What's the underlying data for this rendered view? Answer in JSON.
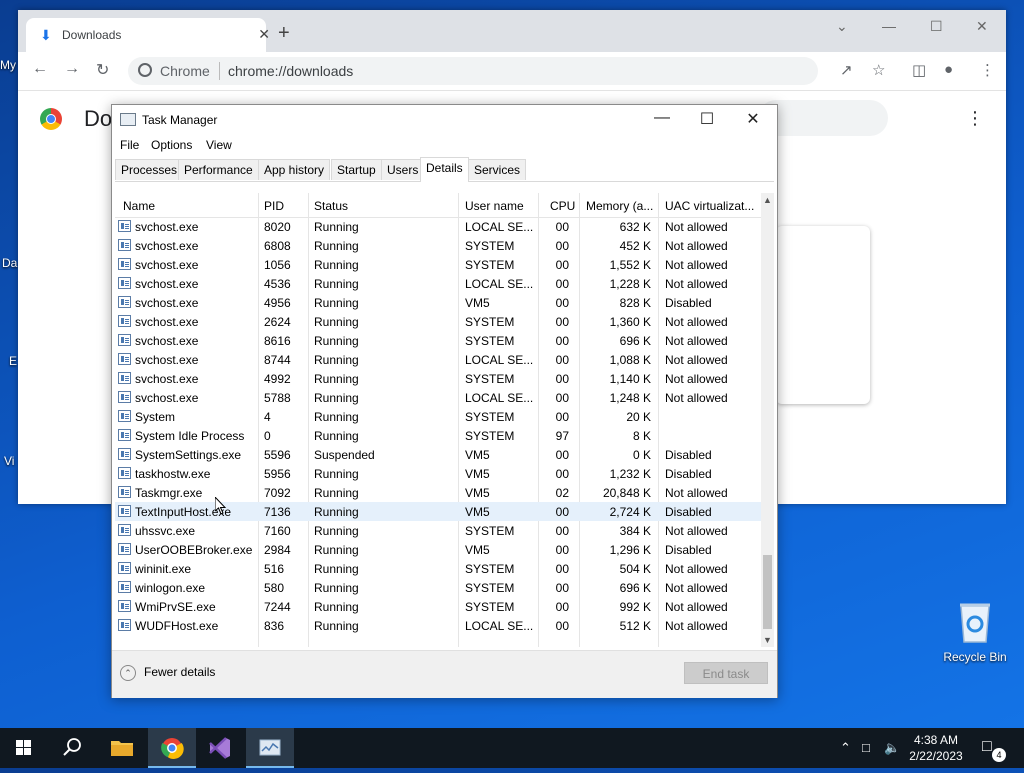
{
  "desktop": {
    "icons": [
      {
        "label": "My"
      },
      {
        "label": "Da"
      },
      {
        "label": "E"
      },
      {
        "label": "Vi"
      }
    ],
    "recycle_bin": "Recycle Bin"
  },
  "chrome": {
    "tab_title": "Downloads",
    "site_label": "Chrome",
    "url": "chrome://downloads",
    "page_title": "Do"
  },
  "task_manager": {
    "title": "Task Manager",
    "menu": [
      "File",
      "Options",
      "View"
    ],
    "tabs": [
      "Processes",
      "Performance",
      "App history",
      "Startup",
      "Users",
      "Details",
      "Services"
    ],
    "active_tab": "Details",
    "columns": [
      "Name",
      "PID",
      "Status",
      "User name",
      "CPU",
      "Memory (a...",
      "UAC virtualizat..."
    ],
    "rows": [
      {
        "name": "svchost.exe",
        "pid": "8020",
        "status": "Running",
        "user": "LOCAL SE...",
        "cpu": "00",
        "mem": "632 K",
        "uac": "Not allowed"
      },
      {
        "name": "svchost.exe",
        "pid": "6808",
        "status": "Running",
        "user": "SYSTEM",
        "cpu": "00",
        "mem": "452 K",
        "uac": "Not allowed"
      },
      {
        "name": "svchost.exe",
        "pid": "1056",
        "status": "Running",
        "user": "SYSTEM",
        "cpu": "00",
        "mem": "1,552 K",
        "uac": "Not allowed"
      },
      {
        "name": "svchost.exe",
        "pid": "4536",
        "status": "Running",
        "user": "LOCAL SE...",
        "cpu": "00",
        "mem": "1,228 K",
        "uac": "Not allowed"
      },
      {
        "name": "svchost.exe",
        "pid": "4956",
        "status": "Running",
        "user": "VM5",
        "cpu": "00",
        "mem": "828 K",
        "uac": "Disabled"
      },
      {
        "name": "svchost.exe",
        "pid": "2624",
        "status": "Running",
        "user": "SYSTEM",
        "cpu": "00",
        "mem": "1,360 K",
        "uac": "Not allowed"
      },
      {
        "name": "svchost.exe",
        "pid": "8616",
        "status": "Running",
        "user": "SYSTEM",
        "cpu": "00",
        "mem": "696 K",
        "uac": "Not allowed"
      },
      {
        "name": "svchost.exe",
        "pid": "8744",
        "status": "Running",
        "user": "LOCAL SE...",
        "cpu": "00",
        "mem": "1,088 K",
        "uac": "Not allowed"
      },
      {
        "name": "svchost.exe",
        "pid": "4992",
        "status": "Running",
        "user": "SYSTEM",
        "cpu": "00",
        "mem": "1,140 K",
        "uac": "Not allowed"
      },
      {
        "name": "svchost.exe",
        "pid": "5788",
        "status": "Running",
        "user": "LOCAL SE...",
        "cpu": "00",
        "mem": "1,248 K",
        "uac": "Not allowed"
      },
      {
        "name": "System",
        "pid": "4",
        "status": "Running",
        "user": "SYSTEM",
        "cpu": "00",
        "mem": "20 K",
        "uac": ""
      },
      {
        "name": "System Idle Process",
        "pid": "0",
        "status": "Running",
        "user": "SYSTEM",
        "cpu": "97",
        "mem": "8 K",
        "uac": ""
      },
      {
        "name": "SystemSettings.exe",
        "pid": "5596",
        "status": "Suspended",
        "user": "VM5",
        "cpu": "00",
        "mem": "0 K",
        "uac": "Disabled"
      },
      {
        "name": "taskhostw.exe",
        "pid": "5956",
        "status": "Running",
        "user": "VM5",
        "cpu": "00",
        "mem": "1,232 K",
        "uac": "Disabled"
      },
      {
        "name": "Taskmgr.exe",
        "pid": "7092",
        "status": "Running",
        "user": "VM5",
        "cpu": "02",
        "mem": "20,848 K",
        "uac": "Not allowed"
      },
      {
        "name": "TextInputHost.exe",
        "pid": "7136",
        "status": "Running",
        "user": "VM5",
        "cpu": "00",
        "mem": "2,724 K",
        "uac": "Disabled"
      },
      {
        "name": "uhssvc.exe",
        "pid": "7160",
        "status": "Running",
        "user": "SYSTEM",
        "cpu": "00",
        "mem": "384 K",
        "uac": "Not allowed"
      },
      {
        "name": "UserOOBEBroker.exe",
        "pid": "2984",
        "status": "Running",
        "user": "VM5",
        "cpu": "00",
        "mem": "1,296 K",
        "uac": "Disabled"
      },
      {
        "name": "wininit.exe",
        "pid": "516",
        "status": "Running",
        "user": "SYSTEM",
        "cpu": "00",
        "mem": "504 K",
        "uac": "Not allowed"
      },
      {
        "name": "winlogon.exe",
        "pid": "580",
        "status": "Running",
        "user": "SYSTEM",
        "cpu": "00",
        "mem": "696 K",
        "uac": "Not allowed"
      },
      {
        "name": "WmiPrvSE.exe",
        "pid": "7244",
        "status": "Running",
        "user": "SYSTEM",
        "cpu": "00",
        "mem": "992 K",
        "uac": "Not allowed"
      },
      {
        "name": "WUDFHost.exe",
        "pid": "836",
        "status": "Running",
        "user": "LOCAL SE...",
        "cpu": "00",
        "mem": "512 K",
        "uac": "Not allowed"
      }
    ],
    "selected_row": "TextInputHost.exe",
    "fewer_details": "Fewer details",
    "end_task": "End task"
  },
  "taskbar": {
    "time": "4:38 AM",
    "date": "2/22/2023",
    "notification_count": "4"
  }
}
